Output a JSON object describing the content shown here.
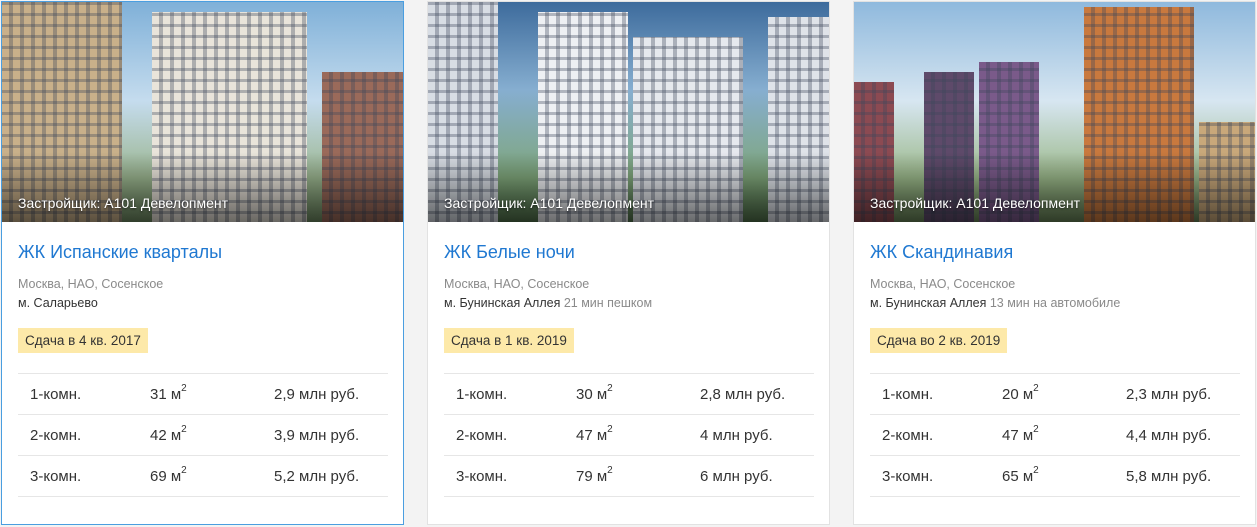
{
  "cards": [
    {
      "developer": "Застройщик: А101 Девелопмент",
      "title": "ЖК Испанские кварталы",
      "address": "Москва, НАО, Сосенское",
      "metro": "м. Саларьево",
      "metro_time": "",
      "completion": "Сдача в 4 кв. 2017",
      "rows": [
        {
          "rooms": "1-комн.",
          "area": "31 м",
          "unit_sup": "2",
          "price": "2,9 млн руб."
        },
        {
          "rooms": "2-комн.",
          "area": "42 м",
          "unit_sup": "2",
          "price": "3,9 млн руб."
        },
        {
          "rooms": "3-комн.",
          "area": "69 м",
          "unit_sup": "2",
          "price": "5,2 млн руб."
        }
      ]
    },
    {
      "developer": "Застройщик: А101 Девелопмент",
      "title": "ЖК Белые ночи",
      "address": "Москва, НАО, Сосенское",
      "metro": "м. Бунинская Аллея",
      "metro_time": "21 мин пешком",
      "completion": "Сдача в 1 кв. 2019",
      "rows": [
        {
          "rooms": "1-комн.",
          "area": "30 м",
          "unit_sup": "2",
          "price": "2,8 млн руб."
        },
        {
          "rooms": "2-комн.",
          "area": "47 м",
          "unit_sup": "2",
          "price": "4 млн руб."
        },
        {
          "rooms": "3-комн.",
          "area": "79 м",
          "unit_sup": "2",
          "price": "6 млн руб."
        }
      ]
    },
    {
      "developer": "Застройщик: А101 Девелопмент",
      "title": "ЖК Скандинавия",
      "address": "Москва, НАО, Сосенское",
      "metro": "м. Бунинская Аллея",
      "metro_time": "13 мин на автомобиле",
      "completion": "Сдача во 2 кв. 2019",
      "rows": [
        {
          "rooms": "1-комн.",
          "area": "20 м",
          "unit_sup": "2",
          "price": "2,3 млн руб."
        },
        {
          "rooms": "2-комн.",
          "area": "47 м",
          "unit_sup": "2",
          "price": "4,4 млн руб."
        },
        {
          "rooms": "3-комн.",
          "area": "65 м",
          "unit_sup": "2",
          "price": "5,8 млн руб."
        }
      ]
    }
  ],
  "colors": {
    "title_link": "#1f78d1",
    "badge_bg": "#fde9a9",
    "active_border": "#4a9ee0"
  }
}
